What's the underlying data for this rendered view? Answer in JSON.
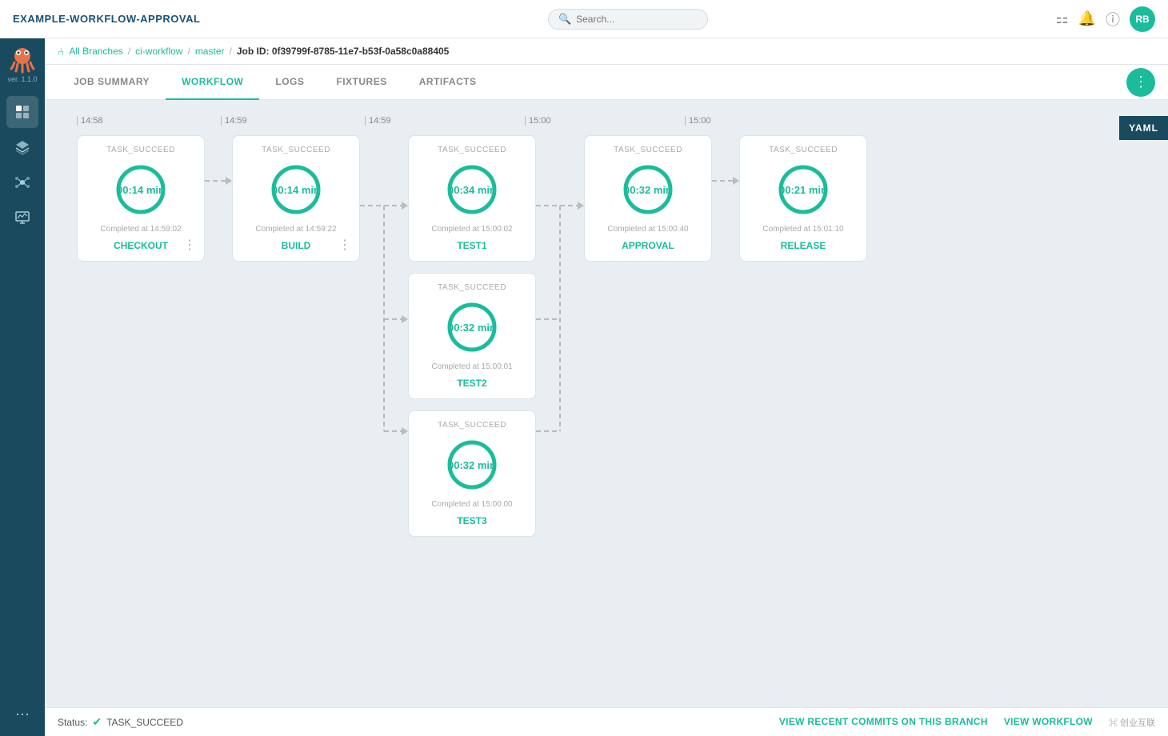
{
  "app": {
    "title": "EXAMPLE-WORKFLOW-APPROVAL",
    "version": "ver. 1.1.0"
  },
  "header": {
    "search_placeholder": "Search...",
    "avatar_initials": "RB"
  },
  "breadcrumb": {
    "branch_icon": "⑃",
    "all_branches": "All Branches",
    "ci_workflow": "ci-workflow",
    "master": "master",
    "job_id_label": "Job ID: 0f39799f-8785-11e7-b53f-0a58c0a88405"
  },
  "tabs": [
    {
      "id": "job-summary",
      "label": "JOB SUMMARY",
      "active": false
    },
    {
      "id": "workflow",
      "label": "WORKFLOW",
      "active": true
    },
    {
      "id": "logs",
      "label": "LOGS",
      "active": false
    },
    {
      "id": "fixtures",
      "label": "FIXTURES",
      "active": false
    },
    {
      "id": "artifacts",
      "label": "ARTIFACTS",
      "active": false
    }
  ],
  "yaml_button": "YAML",
  "timeline": {
    "t1": "14:58",
    "t2": "14:59",
    "t3": "14:59",
    "t4": "15:00",
    "t5": "15:00"
  },
  "nodes": [
    {
      "id": "checkout",
      "status": "TASK_SUCCEED",
      "time": "00:14 min",
      "completed": "Completed at 14:59:02",
      "name": "CHECKOUT",
      "progress": 100,
      "col": 1
    },
    {
      "id": "build",
      "status": "TASK_SUCCEED",
      "time": "00:14 min",
      "completed": "Completed at 14:59:22",
      "name": "BUILD",
      "progress": 100,
      "col": 2
    },
    {
      "id": "test1",
      "status": "TASK_SUCCEED",
      "time": "00:34 min",
      "completed": "Completed at 15:00:02",
      "name": "TEST1",
      "progress": 100,
      "col": 3,
      "row": 1
    },
    {
      "id": "test2",
      "status": "TASK_SUCCEED",
      "time": "00:32 min",
      "completed": "Completed at 15:00:01",
      "name": "TEST2",
      "progress": 100,
      "col": 3,
      "row": 2
    },
    {
      "id": "test3",
      "status": "TASK_SUCCEED",
      "time": "00:32 min",
      "completed": "Completed at 15:00:00",
      "name": "TEST3",
      "progress": 100,
      "col": 3,
      "row": 3
    },
    {
      "id": "approval",
      "status": "TASK_SUCCEED",
      "time": "00:32 min",
      "completed": "Completed at 15:00:40",
      "name": "APPROVAL",
      "progress": 100,
      "col": 4
    },
    {
      "id": "release",
      "status": "TASK_SUCCEED",
      "time": "00:21 min",
      "completed": "Completed at 15:01:10",
      "name": "RELEASE",
      "progress": 100,
      "col": 5
    }
  ],
  "status_bar": {
    "label": "Status:",
    "status": "TASK_SUCCEED",
    "link1": "VIEW RECENT COMMITS ON THIS BRANCH",
    "link2": "VIEW WORKFLOW"
  }
}
